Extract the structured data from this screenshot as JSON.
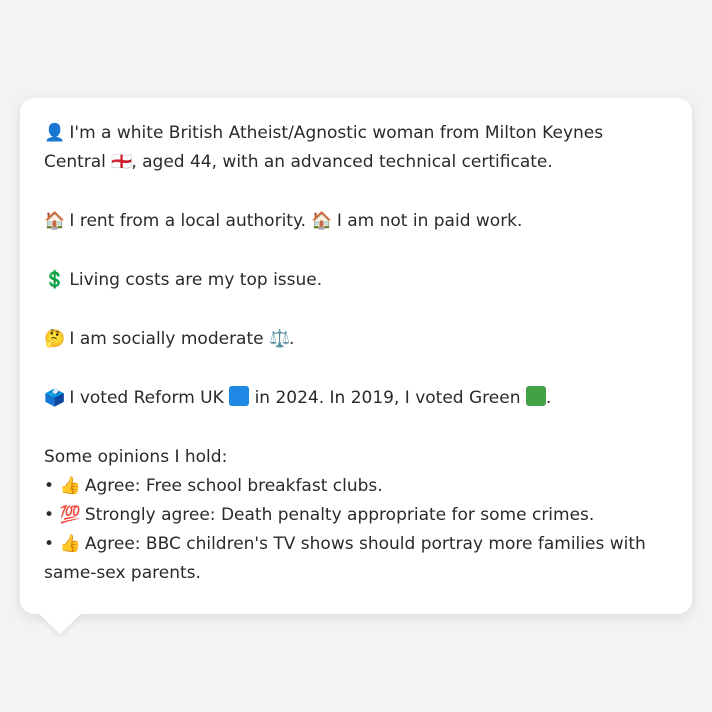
{
  "profile": {
    "line1_icon": "👤",
    "line1_text_a": "I'm a white British Atheist/Agnostic woman from Milton Keynes Central",
    "line1_flag": "🏴󠁧󠁢󠁥󠁮󠁧󠁿",
    "line1_text_b": ", aged 44, with an advanced technical certificate.",
    "line2_icon_a": "🏠",
    "line2_text_a": "I rent from a local authority.",
    "line2_icon_b": "🏠",
    "line2_text_b": "I am not in paid work.",
    "line3_icon": "💲",
    "line3_text": "Living costs are my top issue.",
    "line4_icon": "🤔",
    "line4_text": "I am socially moderate",
    "line4_icon_b": "⚖️",
    "line4_end": ".",
    "line5_icon": "🗳️",
    "line5_text_a": "I voted Reform UK",
    "reform_color": "#1e88e5",
    "line5_text_b": "in 2024. In 2019, I voted Green",
    "green_color": "#43a047",
    "line5_end": "."
  },
  "opinions": {
    "heading": "Some opinions I hold:",
    "bullet": "•",
    "items": [
      {
        "icon": "👍",
        "text": "Agree: Free school breakfast clubs."
      },
      {
        "icon": "💯",
        "text": "Strongly agree: Death penalty appropriate for some crimes."
      },
      {
        "icon": "👍",
        "text": "Agree: BBC children's TV shows should portray more families with same-sex parents."
      }
    ]
  }
}
